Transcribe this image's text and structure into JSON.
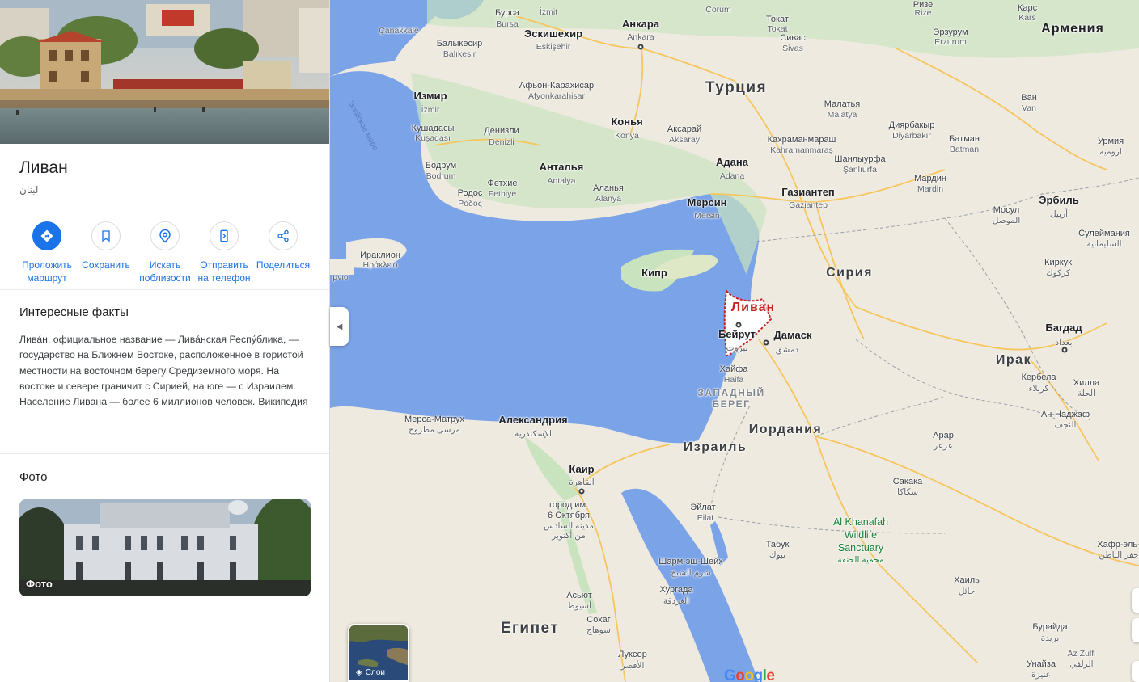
{
  "place": {
    "title": "Ливан",
    "subtitle": "لبنان"
  },
  "actions": [
    {
      "label": "Проложить маршрут",
      "icon": "directions-icon"
    },
    {
      "label": "Сохранить",
      "icon": "bookmark-icon"
    },
    {
      "label": "Искать поблизости",
      "icon": "nearby-icon"
    },
    {
      "label": "Отправить на телефон",
      "icon": "send-to-phone-icon"
    },
    {
      "label": "Поделиться",
      "icon": "share-icon"
    }
  ],
  "facts": {
    "heading": "Интересные факты",
    "text": "Лива́н, официальное название — Лива́нская Респу́блика, — государство на Ближнем Востоке, расположенное в гористой местности на восточном берегу Средиземного моря. На востоке и севере граничит с Сирией, на юге — с Израилем. Население Ливана — более 6 миллионов человек.",
    "link": "Википедия"
  },
  "photos": {
    "heading": "Фото",
    "card_label": "Фото"
  },
  "map": {
    "layers_label": "Слои",
    "google_logo": "Google",
    "colors": {
      "water": "#7ba3e8",
      "land": "#eeeadf",
      "green": "#c9e3bf",
      "road": "#f6c55c",
      "border": "#9aa0a6",
      "highlight": "#c5221f"
    },
    "labels": {
      "bursa": "Бурса",
      "bursa_en": "Bursa",
      "izmit": "İzmit",
      "eskisehir": "Эскишехир",
      "eskisehir_en": "Eskişehir",
      "ankara": "Анкара",
      "ankara_en": "Ankara",
      "corum": "Çorum",
      "tokat_ru": "Токат",
      "tokat": "Tokat",
      "sivas_ru": "Сивас",
      "sivas": "Sivas",
      "rize_ru": "Ризе",
      "rize": "Rize",
      "kars_ru": "Карс",
      "kars": "Kars",
      "erzurum_ru": "Эрзурум",
      "erzurum": "Erzurum",
      "armenia": "Армения",
      "canakkale": "Çanakkale",
      "balikesir_ru": "Балыкесир",
      "balikesir": "Balıkesir",
      "afyon_ru": "Афьон-Карахисар",
      "afyon": "Afyonkarahisar",
      "turkey": "Турция",
      "izmir": "Измир",
      "izmir_en": "İzmir",
      "aegean_sea": "Эгейское море",
      "kusadasi_ru": "Кушадасы",
      "kusadasi": "Kuşadası",
      "denizli_ru": "Денизли",
      "denizli": "Denizli",
      "konya": "Конья",
      "konya_en": "Konya",
      "aksaray_ru": "Аксарай",
      "aksaray": "Aksaray",
      "malatya_ru": "Малатья",
      "malatya": "Malatya",
      "diyarbakir_ru": "Диярбакыр",
      "diyarbakir": "Diyarbakır",
      "batman_ru": "Батман",
      "batman": "Batman",
      "van_ru": "Ван",
      "van": "Van",
      "urmia_ru": "Урмия",
      "urmia": "ارومیه",
      "kahramanmaras_ru": "Кахраманмараш",
      "kahramanmaras": "Kahramanmaraş",
      "sanliurfa_ru": "Шанлыурфа",
      "sanliurfa": "Şanlıurfa",
      "bodrum_ru": "Бодрум",
      "bodrum": "Bodrum",
      "antalya": "Анталья",
      "antalya_en": "Antalya",
      "alanya_ru": "Аланья",
      "alanya": "Alanya",
      "adana": "Адана",
      "adana_en": "Adana",
      "mardin_ru": "Мардин",
      "mardin": "Mardin",
      "fethiye_ru": "Фетхие",
      "fethiye": "Fethiye",
      "rhodes_ru": "Родос",
      "rhodes": "Ρόδος",
      "gaziantep": "Газиантеп",
      "gaziantep_en": "Gaziantep",
      "mersin": "Мерсин",
      "mersin_en": "Mersin",
      "mosul_ru": "Мосул",
      "mosul": "الموصل",
      "erbil": "Эрбиль",
      "erbil_ar": "أربيل",
      "heraklion_ru": "Ираклион",
      "heraklion": "Ηράκλειο",
      "crete_partial": "μνιο",
      "cyprus": "Кипр",
      "syria": "Сирия",
      "sulaymaniyah_ru": "Сулеймания",
      "sulaymaniyah": "السليمانية",
      "kirkuk_ru": "Киркук",
      "kirkuk": "كركوك",
      "lebanon": "Ливан",
      "beirut": "Бейрут",
      "beirut_ar": "بيروت",
      "damascus": "Дамаск",
      "damascus_ar": "دمشق",
      "baghdad": "Багдад",
      "baghdad_ar": "بغداد",
      "haifa_ru": "Хайфа",
      "haifa": "Haifa",
      "iraq": "Ирак",
      "karbala_ru": "Кербела",
      "karbala": "كربلاء",
      "hilla_ru": "Хилла",
      "hilla": "الحلة",
      "west_bank_1": "ЗАПАДНЫЙ",
      "west_bank_2": "БЕРЕГ",
      "najaf_ru": "Ан-Наджаф",
      "najaf": "النجف",
      "marsa_ru": "Мерса-Матрух",
      "marsa": "مرسى مطروح",
      "alexandria": "Александрия",
      "alexandria_ar": "الإسكندرية",
      "israel": "Израиль",
      "jordan": "Иордания",
      "arar_ru": "Арар",
      "arar": "عرعر",
      "cairo": "Каир",
      "cairo_ar": "القاهرة",
      "october_ru_1": "город им.",
      "october_ru_2": "6 Октября",
      "october_ar_1": "مدينة السادس",
      "october_ar_2": "من أكتوبر",
      "sakaka_ru": "Сакака",
      "sakaka": "سكاكا",
      "eilat_ru": "Эйлат",
      "eilat": "Eilat",
      "park_1": "Al Khanafah",
      "park_2": "Wildlife",
      "park_3": "Sanctuary",
      "park_ar": "محمية الخنفة",
      "tabuk_ru": "Табук",
      "tabuk": "تبوك",
      "hafar_ru": "Хафр-эль-",
      "hafar": "حفر الباطن",
      "sharm_ru": "Шарм-эш-Шейх",
      "sharm": "شرم الشيخ",
      "hurghada_ru": "Хургада",
      "hurghada": "الغردقة",
      "hail_ru": "Хаиль",
      "hail": "حائل",
      "asyut_ru": "Асьют",
      "asyut": "أسيوط",
      "sohag_ru": "Сохаг",
      "sohag": "سوهاج",
      "buraydah_ru": "Бурайда",
      "buraydah": "بريدة",
      "egypt": "Египет",
      "luxor_ru": "Луксор",
      "luxor": "الأقصر",
      "azzulfi": "Az Zulfi",
      "azzulfi_ar": "الزلفي",
      "unayzah_ru": "Унайза",
      "unayzah": "عنيزة"
    }
  }
}
